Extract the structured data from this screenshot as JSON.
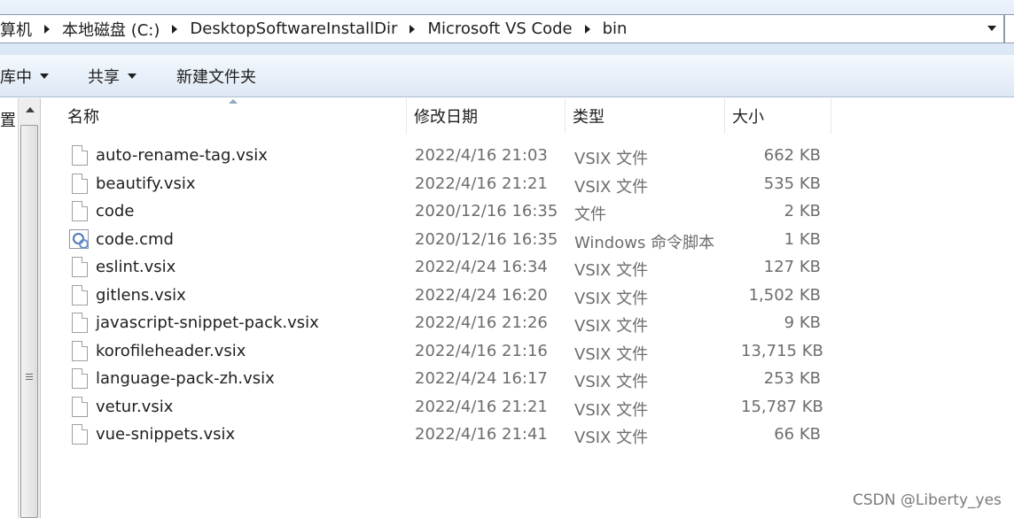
{
  "address_bar": {
    "crumbs": [
      "算机",
      "本地磁盘 (C:)",
      "DesktopSoftwareInstallDir",
      "Microsoft VS Code",
      "bin"
    ]
  },
  "toolbar": {
    "library_label": "库中",
    "share_label": "共享",
    "new_folder_label": "新建文件夹"
  },
  "nav": {
    "partial_item": "置"
  },
  "columns": {
    "name": "名称",
    "date": "修改日期",
    "type": "类型",
    "size": "大小"
  },
  "files": [
    {
      "name": "auto-rename-tag.vsix",
      "date": "2022/4/16 21:03",
      "type": "VSIX 文件",
      "size": "662 KB",
      "icon": "file-icon"
    },
    {
      "name": "beautify.vsix",
      "date": "2022/4/16 21:21",
      "type": "VSIX 文件",
      "size": "535 KB",
      "icon": "file-icon"
    },
    {
      "name": "code",
      "date": "2020/12/16 16:35",
      "type": "文件",
      "size": "2 KB",
      "icon": "file-icon"
    },
    {
      "name": "code.cmd",
      "date": "2020/12/16 16:35",
      "type": "Windows 命令脚本",
      "size": "1 KB",
      "icon": "cmd-script-icon"
    },
    {
      "name": "eslint.vsix",
      "date": "2022/4/24 16:34",
      "type": "VSIX 文件",
      "size": "127 KB",
      "icon": "file-icon"
    },
    {
      "name": "gitlens.vsix",
      "date": "2022/4/24 16:20",
      "type": "VSIX 文件",
      "size": "1,502 KB",
      "icon": "file-icon"
    },
    {
      "name": "javascript-snippet-pack.vsix",
      "date": "2022/4/16 21:26",
      "type": "VSIX 文件",
      "size": "9 KB",
      "icon": "file-icon"
    },
    {
      "name": "korofileheader.vsix",
      "date": "2022/4/16 21:16",
      "type": "VSIX 文件",
      "size": "13,715 KB",
      "icon": "file-icon"
    },
    {
      "name": "language-pack-zh.vsix",
      "date": "2022/4/24 16:17",
      "type": "VSIX 文件",
      "size": "253 KB",
      "icon": "file-icon"
    },
    {
      "name": "vetur.vsix",
      "date": "2022/4/16 21:21",
      "type": "VSIX 文件",
      "size": "15,787 KB",
      "icon": "file-icon"
    },
    {
      "name": "vue-snippets.vsix",
      "date": "2022/4/16 21:41",
      "type": "VSIX 文件",
      "size": "66 KB",
      "icon": "file-icon"
    }
  ],
  "watermark": "CSDN @Liberty_yes"
}
